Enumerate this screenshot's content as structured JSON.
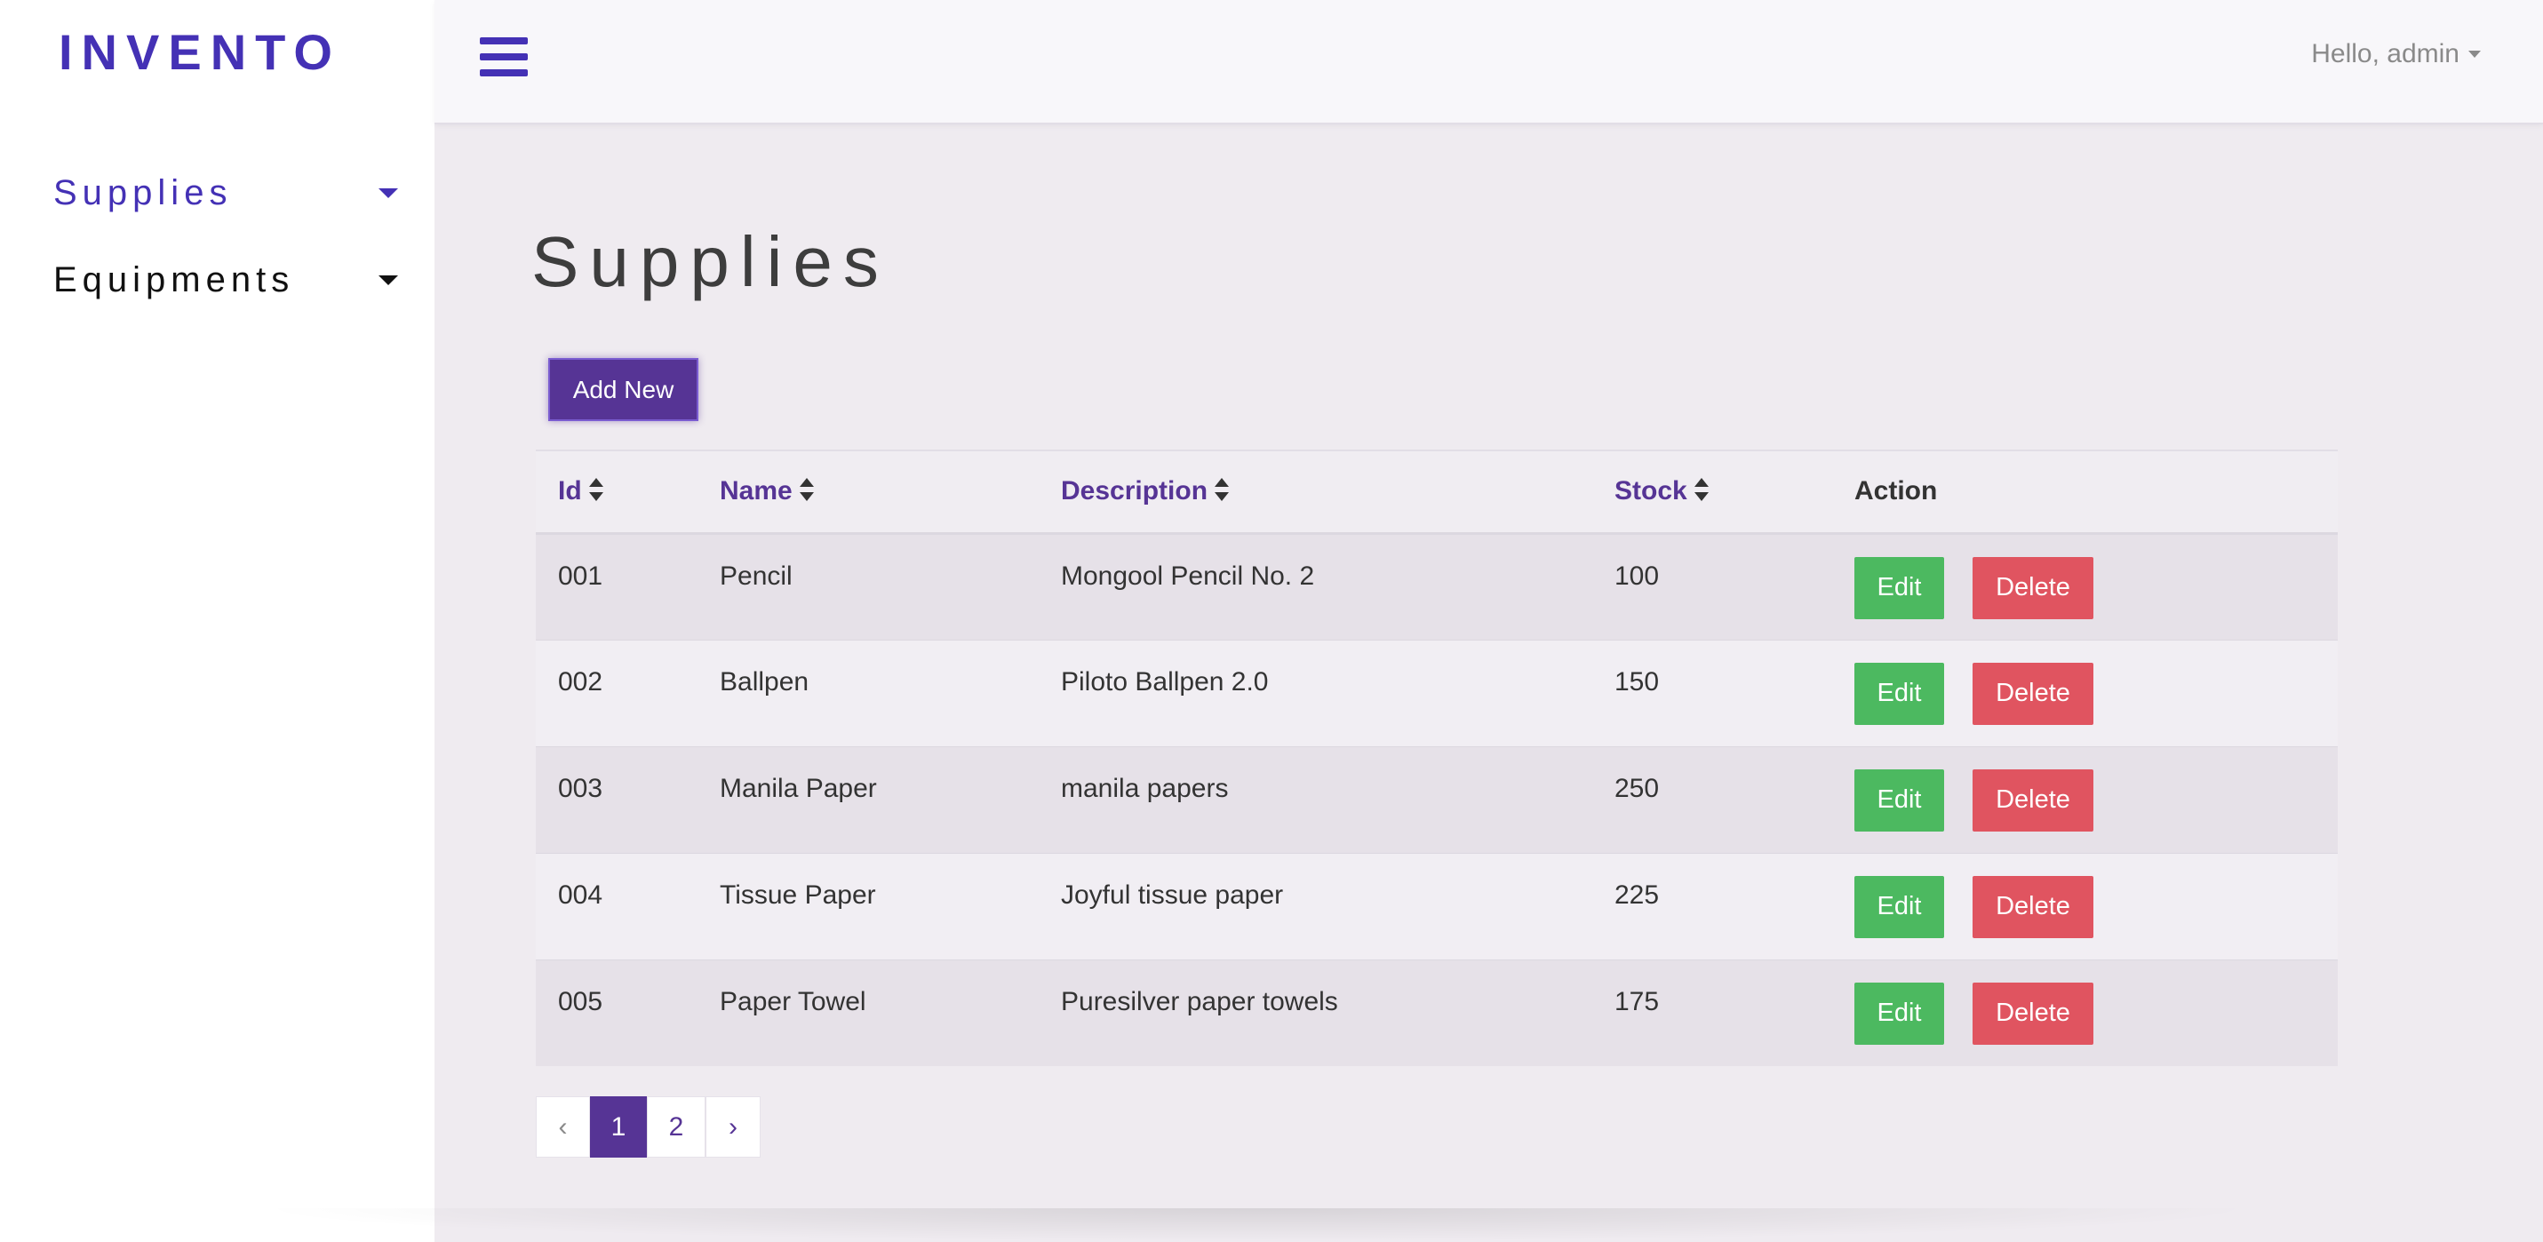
{
  "app": {
    "brand": "INVENTO"
  },
  "sidebar": {
    "items": [
      {
        "label": "Supplies",
        "active": true
      },
      {
        "label": "Equipments",
        "active": false
      }
    ]
  },
  "header": {
    "menu_icon": "hamburger-icon",
    "user_greeting": "Hello, admin"
  },
  "main": {
    "title": "Supplies",
    "add_button": "Add New",
    "table": {
      "columns": [
        "Id",
        "Name",
        "Description",
        "Stock",
        "Action"
      ],
      "rows": [
        {
          "id": "001",
          "name": "Pencil",
          "description": "Mongool Pencil No. 2",
          "stock": "100"
        },
        {
          "id": "002",
          "name": "Ballpen",
          "description": "Piloto Ballpen 2.0",
          "stock": "150"
        },
        {
          "id": "003",
          "name": "Manila Paper",
          "description": "manila papers",
          "stock": "250"
        },
        {
          "id": "004",
          "name": "Tissue Paper",
          "description": "Joyful tissue paper",
          "stock": "225"
        },
        {
          "id": "005",
          "name": "Paper Towel",
          "description": "Puresilver paper towels",
          "stock": "175"
        }
      ],
      "edit_label": "Edit",
      "delete_label": "Delete"
    },
    "pagination": {
      "prev": "‹",
      "pages": [
        "1",
        "2"
      ],
      "current": "1",
      "next": "›"
    }
  },
  "colors": {
    "accent": "#4431b5",
    "primary_button": "#563495",
    "edit_button": "#4cb960",
    "delete_button": "#e05460"
  }
}
